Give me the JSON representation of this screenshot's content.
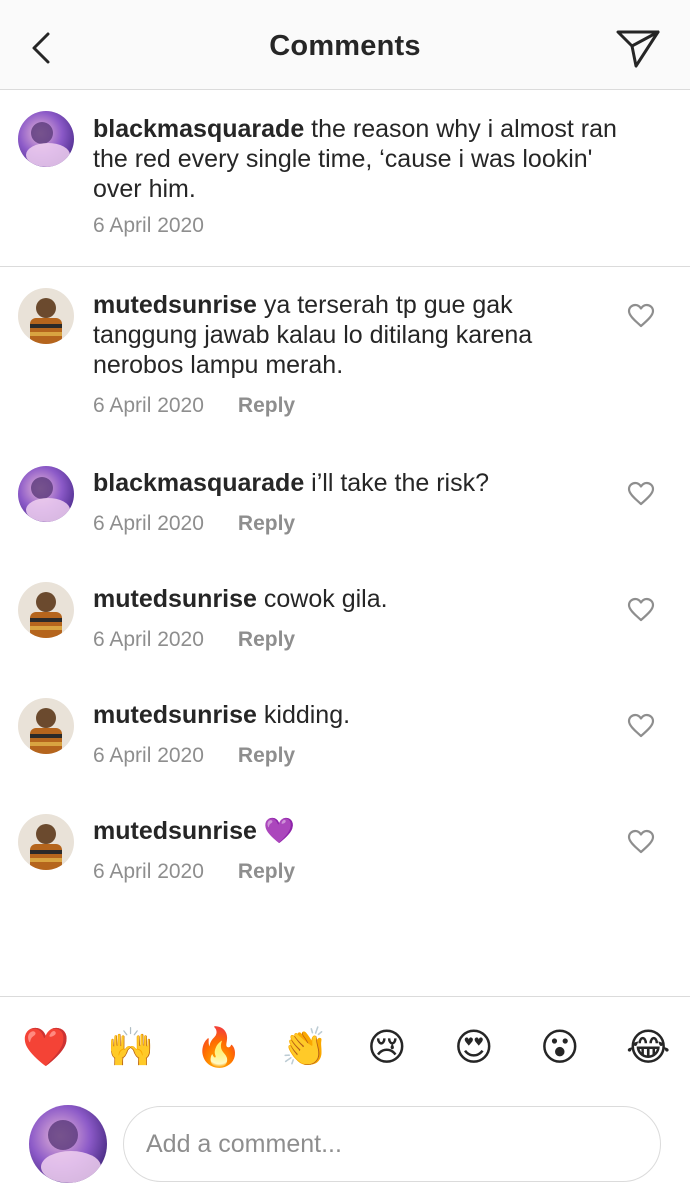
{
  "header": {
    "title": "Comments",
    "back_icon": "chevron-left-icon",
    "send_icon": "paper-plane-icon"
  },
  "caption": {
    "username": "blackmasquarade",
    "text_line1": "the reason why i almost ran",
    "text_line2": "the red every single time, ‘cause i was lookin'",
    "text_line3": "over him.",
    "date": "6 April 2020"
  },
  "comments": [
    {
      "username": "mutedsunrise",
      "text_line1": "ya terserah tp gue gak",
      "text_line2": "tanggung jawab kalau lo ditilang karena",
      "text_line3": "nerobos lampu merah.",
      "date": "6 April 2020",
      "reply_label": "Reply"
    },
    {
      "username": "blackmasquarade",
      "text": "i’ll take the risk?",
      "date": "6 April 2020",
      "reply_label": "Reply"
    },
    {
      "username": "mutedsunrise",
      "text": "cowok gila.",
      "date": "6 April 2020",
      "reply_label": "Reply"
    },
    {
      "username": "mutedsunrise",
      "text": "kidding.",
      "date": "6 April 2020",
      "reply_label": "Reply"
    },
    {
      "username": "mutedsunrise",
      "text": "💜",
      "date": "6 April 2020",
      "reply_label": "Reply"
    }
  ],
  "emoji_bar": [
    "❤️",
    "🙌",
    "🔥",
    "👏",
    "😢",
    "😍",
    "😮",
    "😂"
  ],
  "compose": {
    "placeholder": "Add a comment..."
  },
  "colors": {
    "text": "#262626",
    "secondary": "#8e8e8e",
    "divider": "#dbdbdb",
    "header_bg": "#fafafa"
  }
}
